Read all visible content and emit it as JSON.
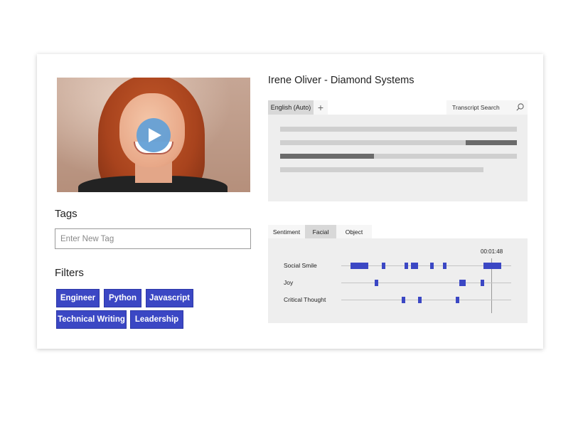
{
  "video": {
    "play_label": "Play"
  },
  "person": {
    "title": "Irene Oliver - Diamond Systems"
  },
  "tags": {
    "title": "Tags",
    "input_placeholder": "Enter New Tag"
  },
  "filters": {
    "title": "Filters",
    "chips": [
      "Engineer",
      "Python",
      "Javascript",
      "Technical Writing",
      "Leadership"
    ]
  },
  "transcript": {
    "language_tab": "English (Auto)",
    "add_tab_symbol": "+",
    "search_label": "Transcript Search",
    "highlight_color": "#6b6b6b",
    "line_color": "#cfcfcf"
  },
  "analytics": {
    "tabs": [
      "Sentiment",
      "Facial",
      "Object"
    ],
    "active_tab": "Facial",
    "timecode": "00:01:48",
    "mark_color": "#3b47c4",
    "rows": [
      {
        "label": "Social Smile"
      },
      {
        "label": "Joy"
      },
      {
        "label": "Critical Thought"
      }
    ]
  },
  "colors": {
    "accent": "#3b47c4",
    "play_button": "#64a0d6"
  }
}
